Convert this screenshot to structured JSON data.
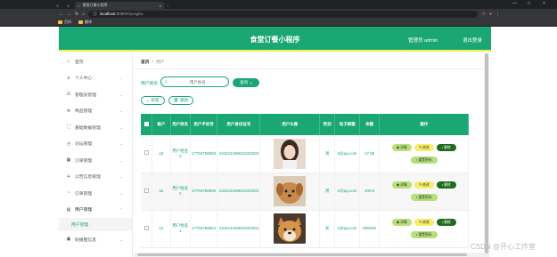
{
  "browser": {
    "tab_title": "食堂订餐小程序",
    "url_host": "localhost",
    "url_path": ":8080/#/yonghu",
    "bookmarks": [
      "百科",
      "翻译"
    ]
  },
  "app": {
    "title": "食堂订餐小程序",
    "user_label": "管理员 admin",
    "logout_label": "退出登录",
    "accent_color": "#1aa774",
    "header_border_color": "#f5ee4d"
  },
  "sidebar": {
    "items": [
      {
        "label": "首页",
        "icon": "home-icon"
      },
      {
        "label": "个人中心",
        "icon": "user-icon"
      },
      {
        "label": "管理员管理",
        "icon": "admin-icon"
      },
      {
        "label": "商品管理",
        "icon": "goods-icon"
      },
      {
        "label": "基础数据管理",
        "icon": "data-icon"
      },
      {
        "label": "论坛管理",
        "icon": "forum-icon"
      },
      {
        "label": "订单管理",
        "icon": "order-icon"
      },
      {
        "label": "公告信息管理",
        "icon": "notice-icon"
      },
      {
        "label": "用户管理",
        "icon": "users-icon"
      }
    ],
    "sub_item": "用户管理",
    "last_item": "轮播图信息"
  },
  "breadcrumb": {
    "home": "首页",
    "sep": "/",
    "current": "用户"
  },
  "search": {
    "label": "用户姓名",
    "placeholder": "用户姓名",
    "button": "查询"
  },
  "actions": {
    "add": "新增",
    "delete": "删除"
  },
  "table": {
    "headers": [
      "",
      "账户",
      "用户姓名",
      "用户手机号",
      "用户身份证号",
      "用户头像",
      "性别",
      "电子邮箱",
      "余额",
      "操作"
    ],
    "rows": [
      {
        "account": "a3",
        "name": "用户姓名3",
        "phone": "17703786903",
        "id_card": "410224199610232003",
        "avatar": "girl-avatar",
        "gender": "男",
        "email": "3@qq.com",
        "balance": "17.86"
      },
      {
        "account": "a2",
        "name": "用户姓名2",
        "phone": "17703786902",
        "id_card": "410224199610232002",
        "avatar": "puppy-avatar",
        "gender": "男",
        "email": "2@qq.com",
        "balance": "409.8"
      },
      {
        "account": "a1",
        "name": "用户姓名1",
        "phone": "17703786901",
        "id_card": "410224199610232001",
        "avatar": "shiba-avatar",
        "gender": "女",
        "email": "1@qq.com",
        "balance": "899260"
      }
    ],
    "ops": {
      "detail": "详情",
      "edit": "修改",
      "delete": "删除",
      "reset_password": "重置密码"
    }
  },
  "watermark": "CSDN @开心工作室"
}
